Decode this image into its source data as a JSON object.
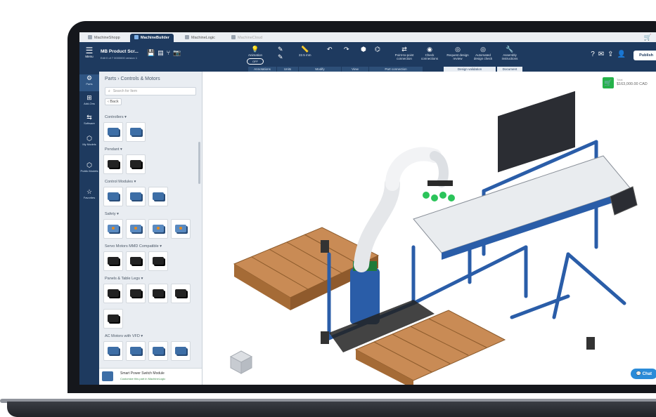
{
  "tabs": [
    {
      "label": "MachineShopp",
      "active": false
    },
    {
      "label": "MachineBuilder",
      "active": true
    },
    {
      "label": "MachineLogic",
      "active": false
    },
    {
      "label": "MachineCloud",
      "active": false
    }
  ],
  "toolbar": {
    "menu_label": "Menu",
    "project_title": "MB Product Scr...",
    "project_subtitle": "Edit 0 of 7 0000000 version 1",
    "tools": [
      {
        "icon": "lightbulb-icon",
        "glyph": "💡",
        "label": "Animation"
      },
      {
        "icon": "pen-icon",
        "glyph": "✎",
        "label": ""
      },
      {
        "icon": "ruler-icon",
        "glyph": "📏",
        "label": "22.5 mm"
      },
      {
        "icon": "undo-icon",
        "glyph": "↶",
        "label": ""
      },
      {
        "icon": "redo-icon",
        "glyph": "↷",
        "label": ""
      },
      {
        "icon": "cube-icon",
        "glyph": "⬢",
        "label": ""
      },
      {
        "icon": "tree-icon",
        "glyph": "⌬",
        "label": ""
      },
      {
        "icon": "point-to-point-icon",
        "glyph": "⇄",
        "label": "Point-to-point connection"
      },
      {
        "icon": "check-connection-icon",
        "glyph": "◉",
        "label": "Check connections"
      },
      {
        "icon": "request-review-icon",
        "glyph": "◎",
        "label": "Request design review"
      },
      {
        "icon": "design-check-icon",
        "glyph": "◎",
        "label": "Automated design check"
      },
      {
        "icon": "wrench-icon",
        "glyph": "🔧",
        "label": "Assembly instructions"
      }
    ],
    "toggle_label": "OFF",
    "sections": [
      "Annotations",
      "Units",
      "Modify",
      "View",
      "Part connection",
      "Design validation",
      "Document"
    ],
    "publish_label": "Publish"
  },
  "rail": [
    {
      "icon": "parts-icon",
      "glyph": "⚙",
      "label": "Parts",
      "active": true
    },
    {
      "icon": "add-ons-icon",
      "glyph": "⊞",
      "label": "Add-Ons",
      "active": false
    },
    {
      "icon": "software-icon",
      "glyph": "⇆",
      "label": "Software",
      "active": false
    },
    {
      "icon": "my-models-icon",
      "glyph": "⬡",
      "label": "My Models",
      "active": false
    },
    {
      "icon": "public-models-icon",
      "glyph": "⬡",
      "label": "Public Models",
      "active": false
    },
    {
      "icon": "favorites-icon",
      "glyph": "☆",
      "label": "Favorites",
      "active": false
    }
  ],
  "panel": {
    "breadcrumb": "Parts › Controls & Motors",
    "search_placeholder": "Search for Item",
    "back_label": "Back",
    "categories": [
      {
        "name": "Controllers ▾",
        "count": 2,
        "style": ""
      },
      {
        "name": "Pendant ▾",
        "count": 2,
        "style": "dark"
      },
      {
        "name": "Control Modules ▾",
        "count": 3,
        "style": ""
      },
      {
        "name": "Safety ▾",
        "count": 4,
        "style": "orange"
      },
      {
        "name": "Servo Motors MMD Compatible ▾",
        "count": 3,
        "style": "dark"
      },
      {
        "name": "Panels & Table Legs ▾",
        "count": 4,
        "style": "dark"
      },
      {
        "name": "",
        "count": 1,
        "style": "dark"
      },
      {
        "name": "AC Motors with VFD ▾",
        "count": 4,
        "style": ""
      }
    ],
    "footer_title": "Smart Power Switch Module",
    "footer_subtitle": "Customize this part in MachineLogic"
  },
  "viewport": {
    "price_label": "Total",
    "price": "$163,000.00 CAD",
    "chat_label": "Chat"
  }
}
